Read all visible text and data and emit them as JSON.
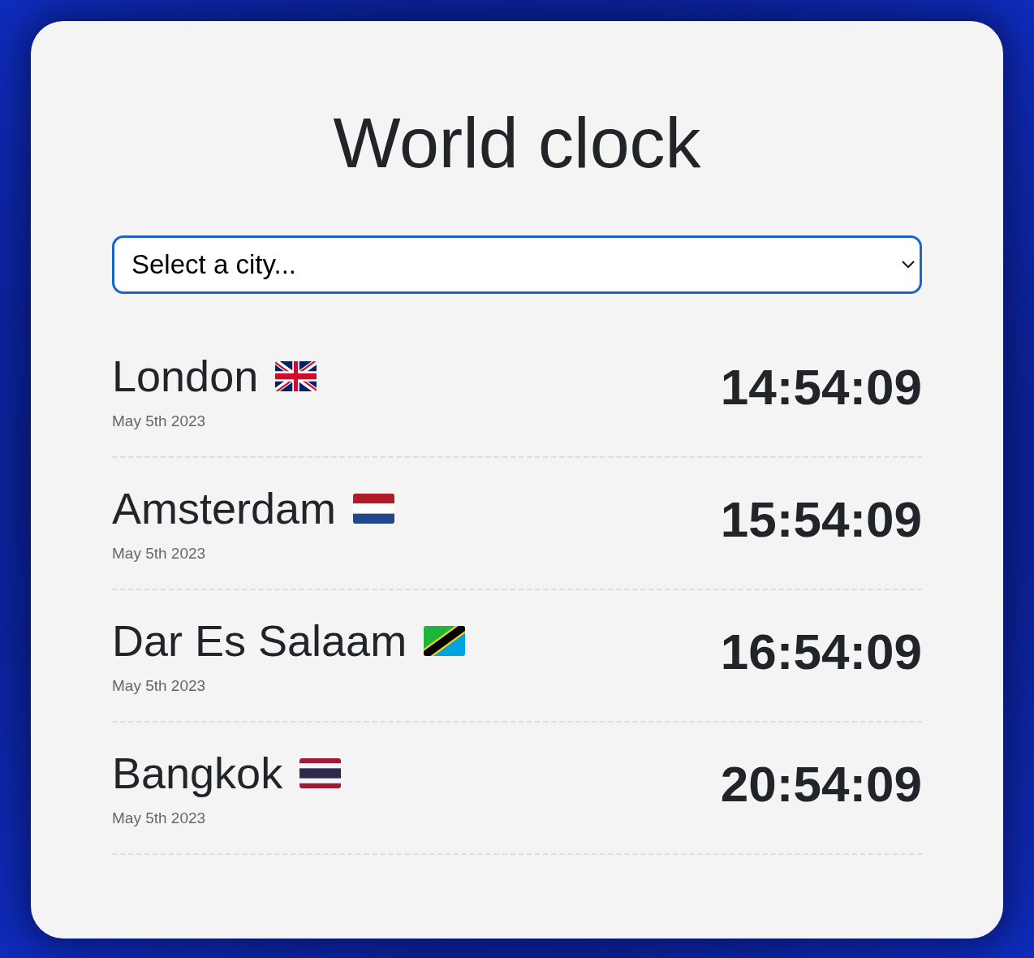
{
  "title": "World clock",
  "city_select": {
    "placeholder": "Select a city..."
  },
  "cities": [
    {
      "name": "London",
      "kind": "gb",
      "date": "May 5th 2023",
      "time": "14:54:09"
    },
    {
      "name": "Amsterdam",
      "kind": "nl",
      "date": "May 5th 2023",
      "time": "15:54:09"
    },
    {
      "name": "Dar Es Salaam",
      "kind": "tz",
      "date": "May 5th 2023",
      "time": "16:54:09"
    },
    {
      "name": "Bangkok",
      "kind": "th",
      "date": "May 5th 2023",
      "time": "20:54:09"
    }
  ]
}
